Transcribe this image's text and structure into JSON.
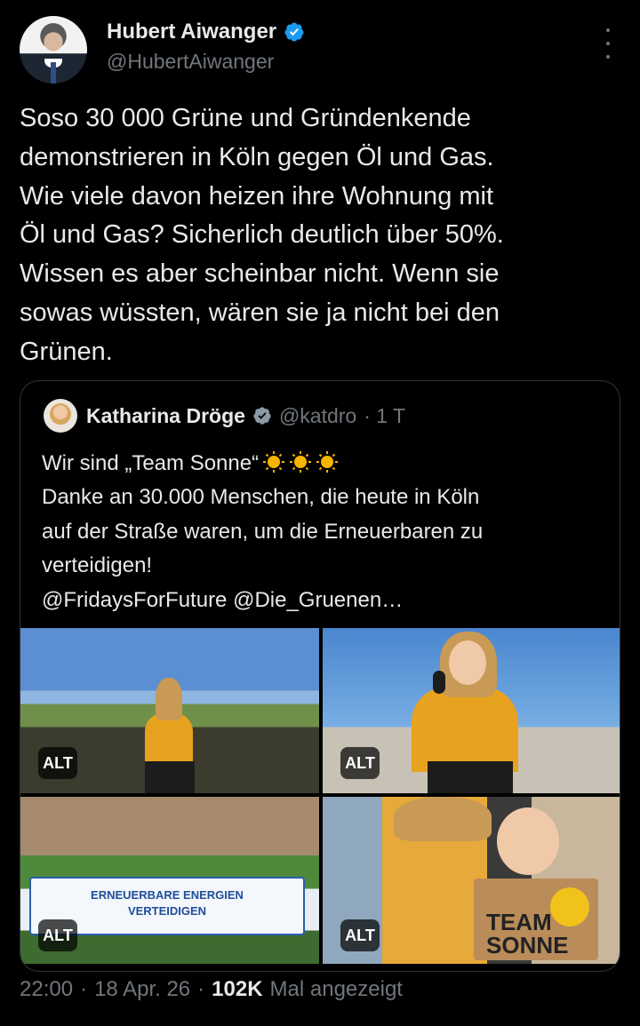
{
  "author": {
    "name": "Hubert Aiwanger",
    "handle": "@HubertAiwanger"
  },
  "tweet": {
    "text": "Soso 30 000 Grüne und Gründenkende\ndemonstrieren in Köln gegen Öl und Gas.\nWie viele davon heizen ihre Wohnung mit\nÖl und Gas? Sicherlich deutlich über 50%.\nWissen es aber scheinbar nicht. Wenn sie\nsowas wüssten, wären sie ja nicht bei den\nGrünen."
  },
  "quote": {
    "name": "Katharina Dröge",
    "handle": "@katdro",
    "time": "· 1 T",
    "line1": "Wir sind „Team Sonne“",
    "body": "Danke an 30.000 Menschen, die heute in Köln\nauf der Straße waren, um die Erneuerbaren zu\nverteidigen!\n@FridaysForFuture @Die_Gruenen…",
    "alt_label": "ALT",
    "banner_text": "ERNEUERBARE ENERGIEN\nVERTEIDIGEN",
    "sign_text": "TEAM\nSONNE"
  },
  "footer": {
    "time": "22:00",
    "sep1": "·",
    "date": "18 Apr. 26",
    "sep2": "·",
    "views": "102K",
    "views_label": "Mal angezeigt"
  },
  "colors": {
    "background": "#000000",
    "text": "#e7e9ea",
    "muted": "#71767b",
    "verified": "#1d9bf0",
    "border": "#333639"
  },
  "icons": [
    "verified-icon",
    "more-icon",
    "sun-icon"
  ]
}
